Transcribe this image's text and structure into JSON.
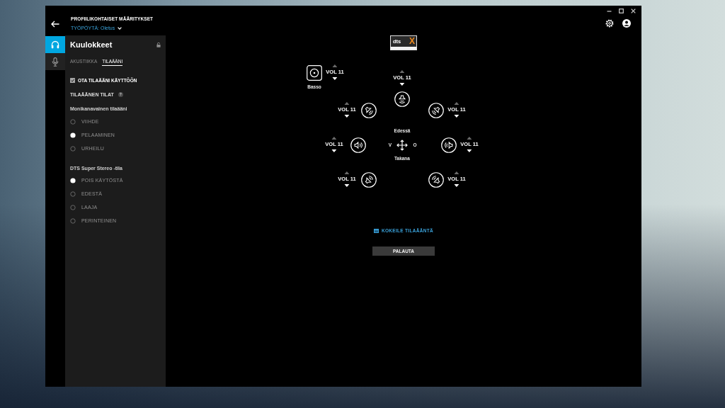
{
  "window": {
    "title": "PROFIILIKOHTAISET MÄÄRITYKSET",
    "profile": {
      "label": "TYÖPÖYTÄ:",
      "value": "Oletus"
    }
  },
  "devices": [
    {
      "kind": "headphones",
      "selected": true
    },
    {
      "kind": "microphone",
      "selected": false
    }
  ],
  "panel": {
    "title": "Kuulokkeet",
    "tabs": [
      {
        "label": "AKUSTIIKKA",
        "selected": false
      },
      {
        "label": "TILAÄÄNI",
        "selected": true
      }
    ],
    "enable": {
      "label": "OTA TILAÄÄNI KÄYTTÖÖN",
      "checked": true
    },
    "section": {
      "title": "TILAÄÄNEN TILAT",
      "help": "?"
    },
    "groups": [
      {
        "title": "Monikanavainen tilaääni",
        "options": [
          {
            "label": "VIIHDE",
            "selected": false
          },
          {
            "label": "PELAAMINEN",
            "selected": true
          },
          {
            "label": "URHEILU",
            "selected": false
          }
        ]
      },
      {
        "title": "DTS Super Stereo -tila",
        "options": [
          {
            "label": "POIS KÄYTÖSTÄ",
            "selected": true
          },
          {
            "label": "EDESTÄ",
            "selected": false
          },
          {
            "label": "LAAJA",
            "selected": false
          },
          {
            "label": "PERINTEINEN",
            "selected": false
          }
        ]
      }
    ]
  },
  "logo": {
    "brand": "dts",
    "mark": "X"
  },
  "speakers": [
    {
      "kind": "bass",
      "label": "Basso",
      "volume": "VOL 11"
    },
    {
      "kind": "center",
      "volume": "VOL 11"
    },
    {
      "kind": "front_left",
      "volume": "VOL 11"
    },
    {
      "kind": "front_right",
      "volume": "VOL 11"
    },
    {
      "kind": "side_left",
      "volume": "VOL 11"
    },
    {
      "kind": "side_right",
      "volume": "VOL 11"
    },
    {
      "kind": "rear_left",
      "volume": "VOL 11"
    },
    {
      "kind": "rear_right",
      "volume": "VOL 11"
    }
  ],
  "orientation": {
    "front": "Edessä",
    "left": "V",
    "right": "O",
    "back": "Takana"
  },
  "test_link": "KOKEILE TILAÄÄNTÄ",
  "reset_button": "PALAUTA"
}
